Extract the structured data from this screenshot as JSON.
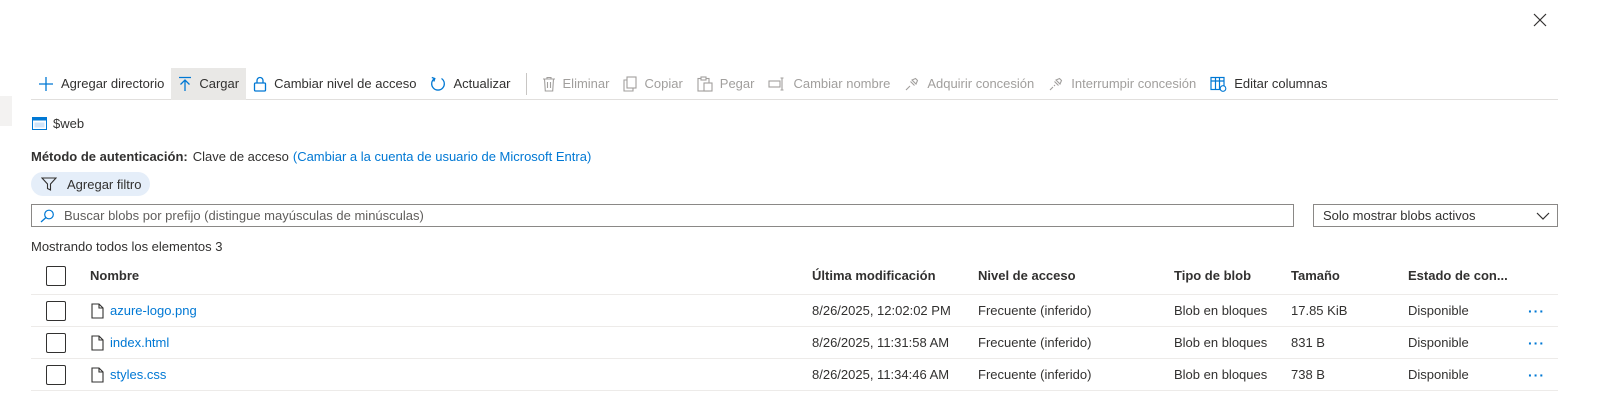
{
  "toolbar": {
    "items": [
      {
        "label": "Agregar directorio",
        "icon": "plus-icon",
        "state": "enabled"
      },
      {
        "label": "Cargar",
        "icon": "upload-icon",
        "state": "active"
      },
      {
        "label": "Cambiar nivel de acceso",
        "icon": "lock-icon",
        "state": "enabled"
      },
      {
        "label": "Actualizar",
        "icon": "refresh-icon",
        "state": "enabled"
      },
      {
        "label": "Eliminar",
        "icon": "trash-icon",
        "state": "disabled"
      },
      {
        "label": "Copiar",
        "icon": "copy-icon",
        "state": "disabled"
      },
      {
        "label": "Pegar",
        "icon": "paste-icon",
        "state": "disabled"
      },
      {
        "label": "Cambiar nombre",
        "icon": "rename-icon",
        "state": "disabled"
      },
      {
        "label": "Adquirir concesión",
        "icon": "lease-icon",
        "state": "disabled"
      },
      {
        "label": "Interrumpir concesión",
        "icon": "break-lease-icon",
        "state": "disabled"
      },
      {
        "label": "Editar columnas",
        "icon": "columns-icon",
        "state": "enabled"
      }
    ]
  },
  "container": {
    "name": "$web",
    "icon": "container-icon"
  },
  "auth": {
    "label": "Método de autenticación:",
    "value": "Clave de acceso",
    "link": "(Cambiar a la cuenta de usuario de Microsoft Entra)"
  },
  "filter": {
    "label": "Agregar filtro",
    "icon": "filter-icon"
  },
  "search": {
    "placeholder": "Buscar blobs por prefijo (distingue mayúsculas de minúsculas)",
    "icon": "search-icon"
  },
  "dropdown": {
    "selected": "Solo mostrar blobs activos",
    "icon": "chevron-down-icon"
  },
  "count_text": "Mostrando todos los elementos 3",
  "table": {
    "columns": [
      "Nombre",
      "Última modificación",
      "Nivel de acceso",
      "Tipo de blob",
      "Tamaño",
      "Estado de con..."
    ],
    "rows": [
      {
        "name": "azure-logo.png",
        "modified": "8/26/2025, 12:02:02 PM",
        "tier": "Frecuente (inferido)",
        "type": "Blob en bloques",
        "size": "17.85 KiB",
        "state": "Disponible",
        "more": "···"
      },
      {
        "name": "index.html",
        "modified": "8/26/2025, 11:31:58 AM",
        "tier": "Frecuente (inferido)",
        "type": "Blob en bloques",
        "size": "831 B",
        "state": "Disponible",
        "more": "···"
      },
      {
        "name": "styles.css",
        "modified": "8/26/2025, 11:34:46 AM",
        "tier": "Frecuente (inferido)",
        "type": "Blob en bloques",
        "size": "738 B",
        "state": "Disponible",
        "more": "···"
      }
    ]
  },
  "colors": {
    "accent": "#0078d4",
    "text": "#323130",
    "disabled": "#a19f9d",
    "pill": "#e5eef9"
  }
}
